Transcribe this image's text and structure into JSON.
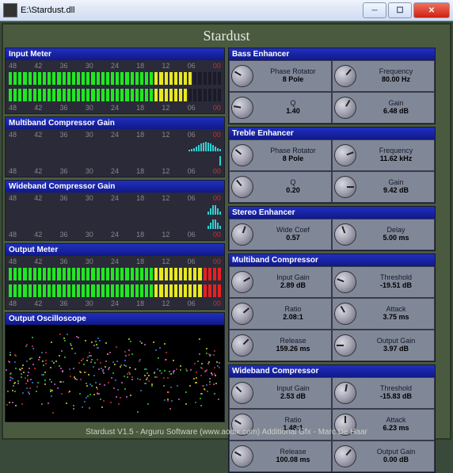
{
  "window": {
    "title": "E:\\Stardust.dll"
  },
  "plugin_title": "Stardust",
  "scale": [
    "48",
    "42",
    "36",
    "30",
    "24",
    "18",
    "12",
    "06",
    "00"
  ],
  "left_panels": {
    "input_meter": "Input Meter",
    "mb_gain": "Multiband Compressor Gain",
    "wb_gain": "Wideband Compressor Gain",
    "output_meter": "Output Meter",
    "osc": "Output Oscilloscope"
  },
  "sections": {
    "bass": {
      "title": "Bass Enhancer",
      "params": [
        {
          "label": "Phase Rotator",
          "value": "8 Pole"
        },
        {
          "label": "Frequency",
          "value": "80.00 Hz"
        },
        {
          "label": "Q",
          "value": "1.40"
        },
        {
          "label": "Gain",
          "value": "6.48 dB"
        }
      ]
    },
    "treble": {
      "title": "Treble Enhancer",
      "params": [
        {
          "label": "Phase Rotator",
          "value": "8 Pole"
        },
        {
          "label": "Frequency",
          "value": "11.62 kHz"
        },
        {
          "label": "Q",
          "value": "0.20"
        },
        {
          "label": "Gain",
          "value": "9.42 dB"
        }
      ]
    },
    "stereo": {
      "title": "Stereo Enhancer",
      "params": [
        {
          "label": "Wide Coef",
          "value": "0.57"
        },
        {
          "label": "Delay",
          "value": "5.00 ms"
        }
      ]
    },
    "mbcomp": {
      "title": "Multiband Compressor",
      "params": [
        {
          "label": "Input Gain",
          "value": "2.89 dB"
        },
        {
          "label": "Threshold",
          "value": "-19.51 dB"
        },
        {
          "label": "Ratio",
          "value": "2.08:1"
        },
        {
          "label": "Attack",
          "value": "3.75 ms"
        },
        {
          "label": "Release",
          "value": "159.26 ms"
        },
        {
          "label": "Output Gain",
          "value": "3.97 dB"
        }
      ]
    },
    "wbcomp": {
      "title": "Wideband Compressor",
      "params": [
        {
          "label": "Input Gain",
          "value": "2.53 dB"
        },
        {
          "label": "Threshold",
          "value": "-15.83 dB"
        },
        {
          "label": "Ratio",
          "value": "1.48:1"
        },
        {
          "label": "Attack",
          "value": "6.23 ms"
        },
        {
          "label": "Release",
          "value": "100.08 ms"
        },
        {
          "label": "Output Gain",
          "value": "0.00 dB"
        }
      ]
    }
  },
  "footer": "Stardust V1.5 - Arguru Software (www.aodix.com)   Additional Gfx - Marc De Haar"
}
